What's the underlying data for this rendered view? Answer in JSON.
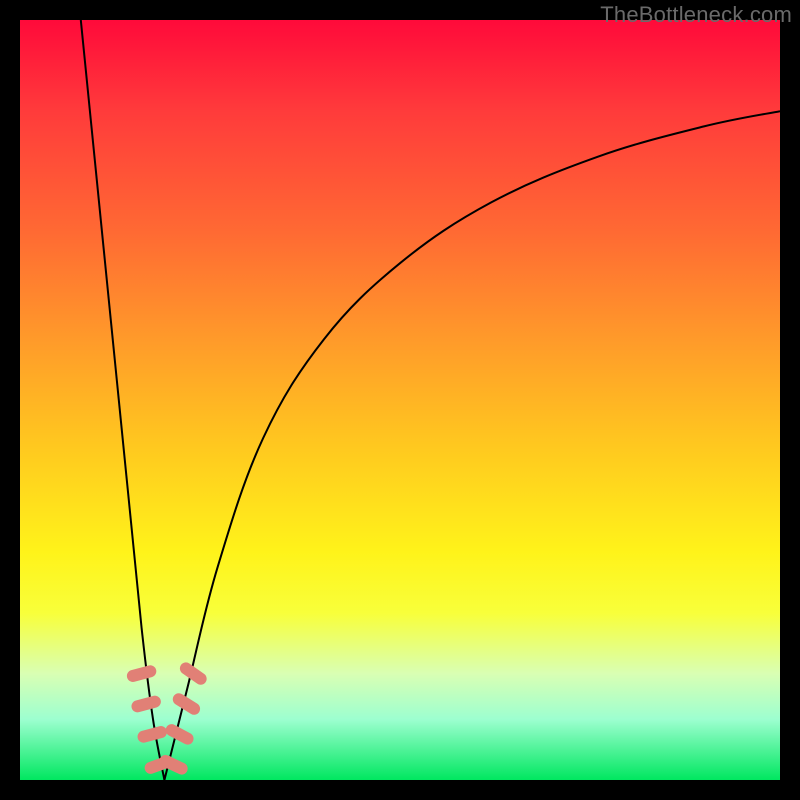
{
  "watermark": "TheBottleneck.com",
  "colors": {
    "gradient_top": "#ff0a3a",
    "gradient_bottom": "#00e760",
    "curve": "#000000",
    "markers": "#e18076",
    "frame": "#000000"
  },
  "chart_data": {
    "type": "line",
    "title": "",
    "xlabel": "",
    "ylabel": "",
    "xlim": [
      0,
      100
    ],
    "ylim": [
      0,
      100
    ],
    "grid": false,
    "curve_left": {
      "description": "steep descending segment from top-left toward minimum",
      "points": [
        {
          "x": 8,
          "y": 100
        },
        {
          "x": 10,
          "y": 80
        },
        {
          "x": 12,
          "y": 60
        },
        {
          "x": 14,
          "y": 40
        },
        {
          "x": 16,
          "y": 20
        },
        {
          "x": 17.5,
          "y": 8
        },
        {
          "x": 19,
          "y": 0
        }
      ]
    },
    "curve_right": {
      "description": "rising concave segment from minimum toward upper-right",
      "points": [
        {
          "x": 19,
          "y": 0
        },
        {
          "x": 22,
          "y": 12
        },
        {
          "x": 26,
          "y": 28
        },
        {
          "x": 32,
          "y": 45
        },
        {
          "x": 40,
          "y": 58
        },
        {
          "x": 50,
          "y": 68
        },
        {
          "x": 62,
          "y": 76
        },
        {
          "x": 76,
          "y": 82
        },
        {
          "x": 90,
          "y": 86
        },
        {
          "x": 100,
          "y": 88
        }
      ]
    },
    "minimum": {
      "x": 19,
      "y": 0
    },
    "markers": {
      "description": "salmon-colored capsule markers clustered near the minimum on both branches",
      "points": [
        {
          "x": 16.0,
          "y": 14,
          "rot": 75
        },
        {
          "x": 16.6,
          "y": 10,
          "rot": 75
        },
        {
          "x": 17.4,
          "y": 6,
          "rot": 75
        },
        {
          "x": 18.3,
          "y": 2,
          "rot": 70
        },
        {
          "x": 20.2,
          "y": 2,
          "rot": -65
        },
        {
          "x": 21.0,
          "y": 6,
          "rot": -62
        },
        {
          "x": 21.9,
          "y": 10,
          "rot": -58
        },
        {
          "x": 22.8,
          "y": 14,
          "rot": -55
        }
      ]
    }
  }
}
